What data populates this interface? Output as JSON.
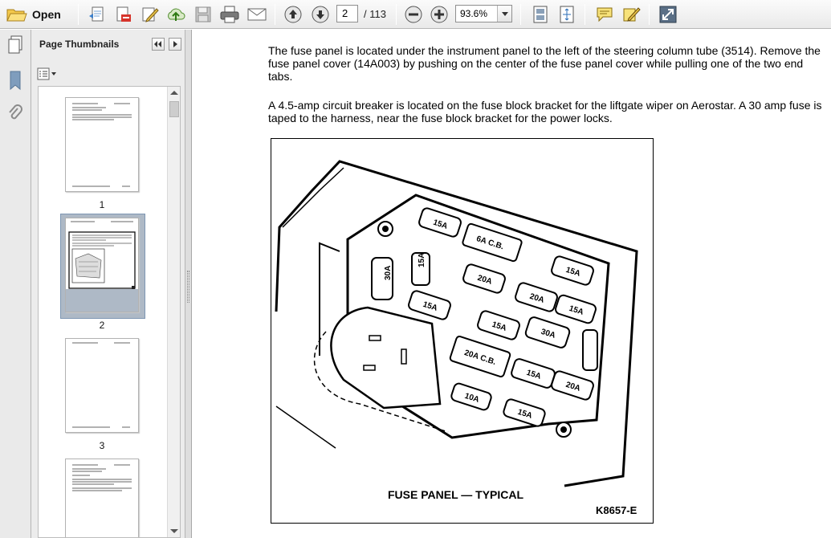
{
  "toolbar": {
    "open_label": "Open",
    "current_page": "2",
    "page_total": "/ 113",
    "zoom": "93.6%"
  },
  "thumbnails_panel": {
    "title": "Page Thumbnails",
    "pages": [
      {
        "label": "1"
      },
      {
        "label": "2",
        "selected": true
      },
      {
        "label": "3"
      },
      {
        "label": ""
      }
    ]
  },
  "document": {
    "paragraph_1": "The fuse panel is located under the instrument panel to the left of the steering column tube (3514). Remove the fuse panel cover (14A003) by pushing on the center of the fuse panel cover while pulling one of the two end tabs.",
    "paragraph_2": "A 4.5-amp circuit breaker is located on the fuse block bracket for the liftgate wiper on Aerostar. A 30 amp fuse is taped to the harness, near the fuse block bracket for the power locks.",
    "figure": {
      "caption": "FUSE PANEL — TYPICAL",
      "code": "K8657-E",
      "fuse_labels": [
        "15A",
        "6A C.B.",
        "15A",
        "30A",
        "20A",
        "15A",
        "20A",
        "15A",
        "15A",
        "30A",
        "15A",
        "20A C.B.",
        "15A",
        "20A",
        "10A",
        "15A"
      ]
    }
  },
  "colors": {
    "selection": "#aeb9c6",
    "toolbar_bg": "#e9e9e9",
    "panel_bg": "#ececec"
  }
}
